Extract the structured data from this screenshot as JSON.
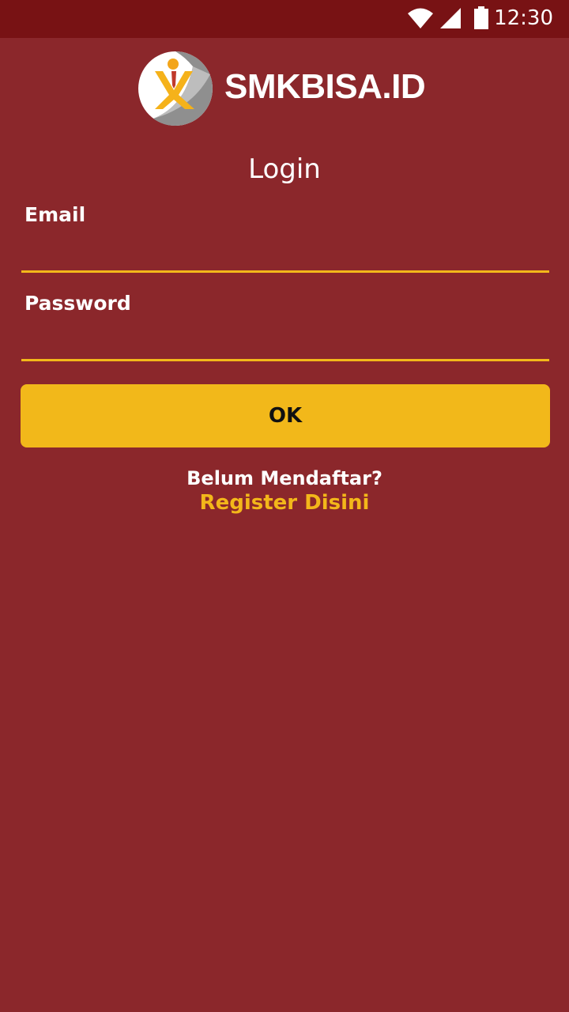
{
  "status_bar": {
    "time": "12:30",
    "icons": [
      "wifi-icon",
      "cell-signal-icon",
      "battery-icon"
    ]
  },
  "header": {
    "brand": "SMKBISA.ID",
    "logo_icon": "smkbisa-logo-icon"
  },
  "login": {
    "title": "Login",
    "email_label": "Email",
    "email_value": "",
    "password_label": "Password",
    "password_value": "",
    "ok_label": "OK",
    "not_registered_text": "Belum Mendaftar?",
    "register_link": "Register Disini"
  },
  "colors": {
    "background": "#8B272B",
    "status_bar": "#781214",
    "accent": "#F2B81A",
    "text": "#FFFFFF"
  }
}
